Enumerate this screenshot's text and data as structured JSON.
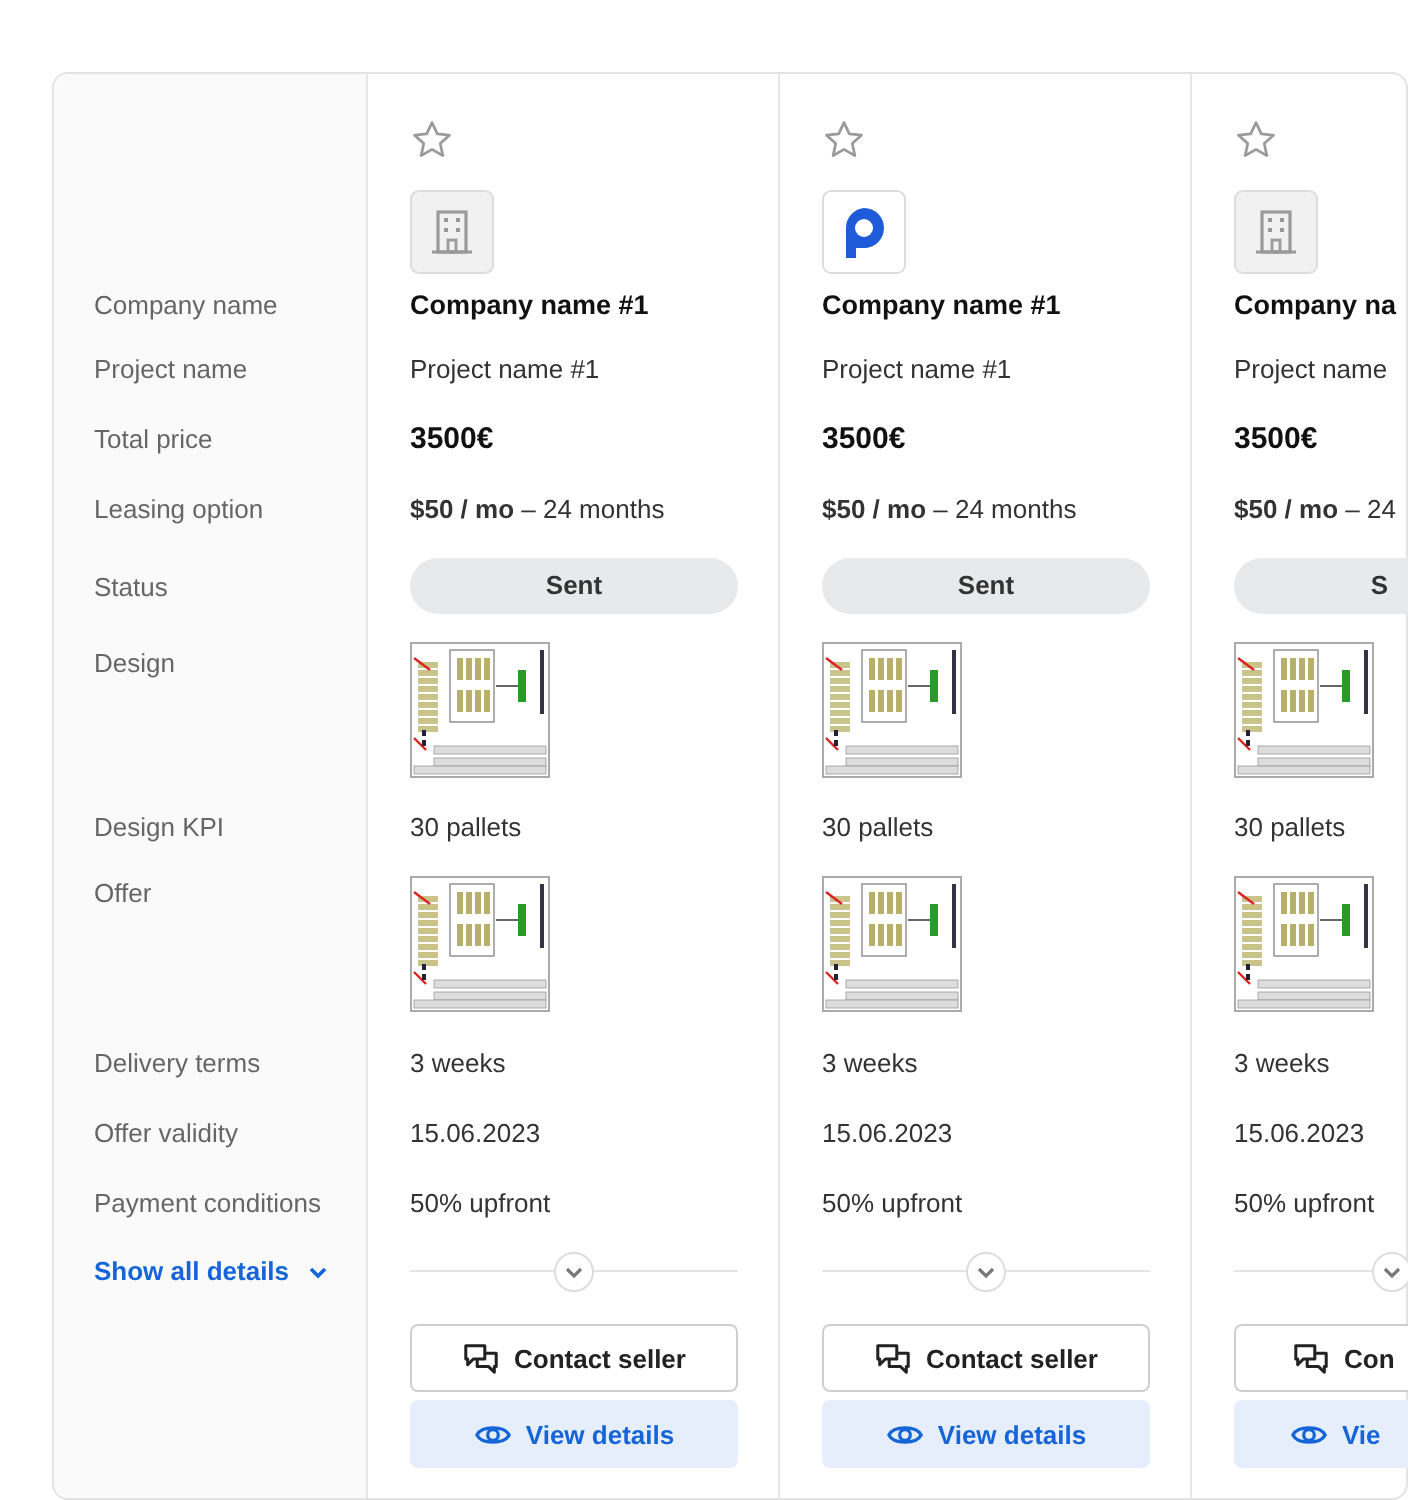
{
  "labels": [
    "Company name",
    "Project name",
    "Total price",
    "Leasing option",
    "Status",
    "Design",
    "Design KPI",
    "Offer",
    "Delivery terms",
    "Offer validity",
    "Payment conditions"
  ],
  "show_all": "Show all details",
  "columns": [
    {
      "starred": false,
      "logo": {
        "kind": "building"
      },
      "company": "Company name #1",
      "project": "Project name #1",
      "price": "3500€",
      "leasing": "**$50 / mo** – 24 months",
      "status": "Sent",
      "design_kpi": "30 pallets",
      "delivery": "3 weeks",
      "validity": "15.06.2023",
      "payment": "50% upfront",
      "contact": "Contact seller",
      "view": "View details"
    },
    {
      "starred": false,
      "logo": {
        "kind": "brand"
      },
      "company": "Company name #1",
      "project": "Project name #1",
      "price": "3500€",
      "leasing": "**$50 / mo** – 24 months",
      "status": "Sent",
      "design_kpi": "30 pallets",
      "delivery": "3 weeks",
      "validity": "15.06.2023",
      "payment": "50% upfront",
      "contact": "Contact seller",
      "view": "View details"
    },
    {
      "starred": false,
      "logo": {
        "kind": "building"
      },
      "company": "Company na",
      "project": "Project name",
      "price": "3500€",
      "leasing": "**$50 / mo** – 24",
      "status": "S",
      "design_kpi": "30 pallets",
      "delivery": "3 weeks",
      "validity": "15.06.2023",
      "payment": "50% upfront",
      "contact": "Con",
      "view": "Vie"
    }
  ]
}
